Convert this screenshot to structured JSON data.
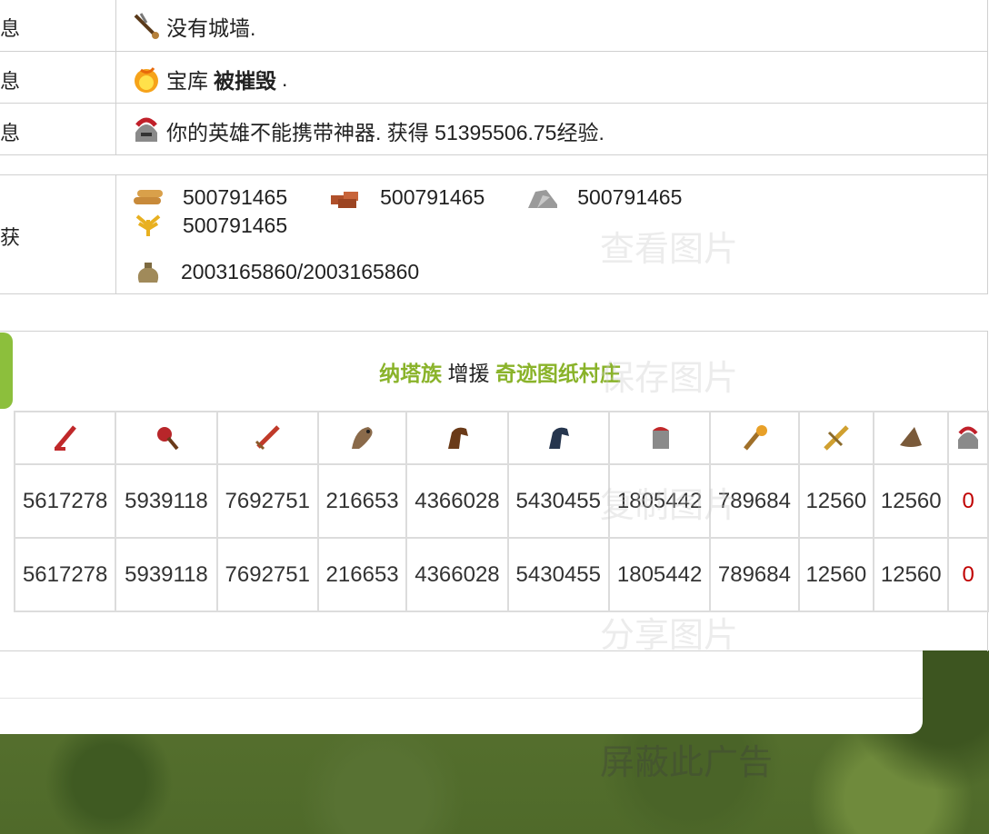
{
  "report": {
    "rows": [
      {
        "label": "息",
        "icon": "catapult-icon",
        "text_pre": "没有城墙.",
        "text_bold": "",
        "text_post": ""
      },
      {
        "label": "息",
        "icon": "fire-icon",
        "text_pre": "宝库 ",
        "text_bold": "被摧毁",
        "text_post": "."
      },
      {
        "label": "息",
        "icon": "hero-helmet-icon",
        "text_pre": "你的英雄不能携带神器. 获得 51395506.75经验.",
        "text_bold": "",
        "text_post": ""
      }
    ],
    "bounty_label": "获",
    "resources": {
      "wood": "500791465",
      "clay": "500791465",
      "iron": "500791465",
      "crop": "500791465"
    },
    "carry": "2003165860/2003165860"
  },
  "reinforcement": {
    "tribe": "纳塔族",
    "action": "增援",
    "target": "奇迹图纸村庄",
    "unit_icons": [
      "spear-icon",
      "mace-icon",
      "sword-icon",
      "hawk-icon",
      "brown-horse-icon",
      "blue-horse-icon",
      "ram-icon",
      "catapult-icon",
      "settler-sword-icon",
      "wizard-hat-icon",
      "hero-icon"
    ],
    "rows": [
      [
        "5617278",
        "5939118",
        "7692751",
        "216653",
        "4366028",
        "5430455",
        "1805442",
        "789684",
        "12560",
        "12560",
        "0"
      ],
      [
        "5617278",
        "5939118",
        "7692751",
        "216653",
        "4366028",
        "5430455",
        "1805442",
        "789684",
        "12560",
        "12560",
        "0"
      ]
    ]
  },
  "context_menu_faint": [
    "查看图片",
    "保存图片",
    "复制图片",
    "分享图片",
    "屏蔽此广告"
  ],
  "colors": {
    "accent_green": "#8ab32a",
    "zero_red": "#c00000"
  }
}
